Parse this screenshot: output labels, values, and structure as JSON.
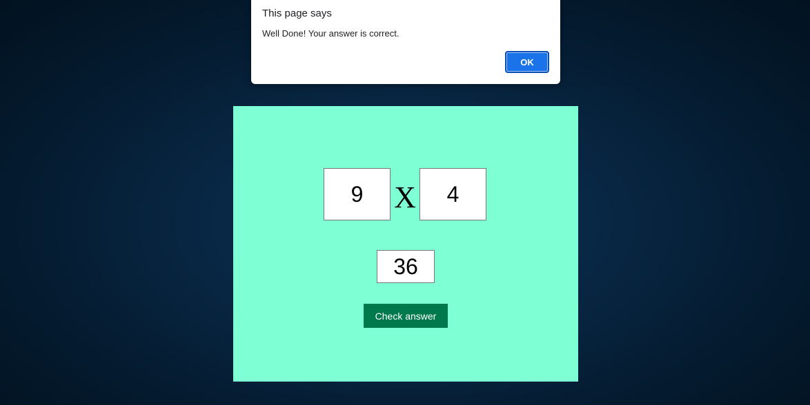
{
  "alert": {
    "title": "This page says",
    "message": "Well Done! Your answer is correct.",
    "ok_label": "OK"
  },
  "quiz": {
    "operand_a": "9",
    "operator": "X",
    "operand_b": "4",
    "answer_value": "36",
    "check_label": "Check answer"
  },
  "colors": {
    "page_background": "#041a2e",
    "card_background": "#7fffd4",
    "check_button": "#007a4d",
    "ok_button": "#1a73e8"
  }
}
